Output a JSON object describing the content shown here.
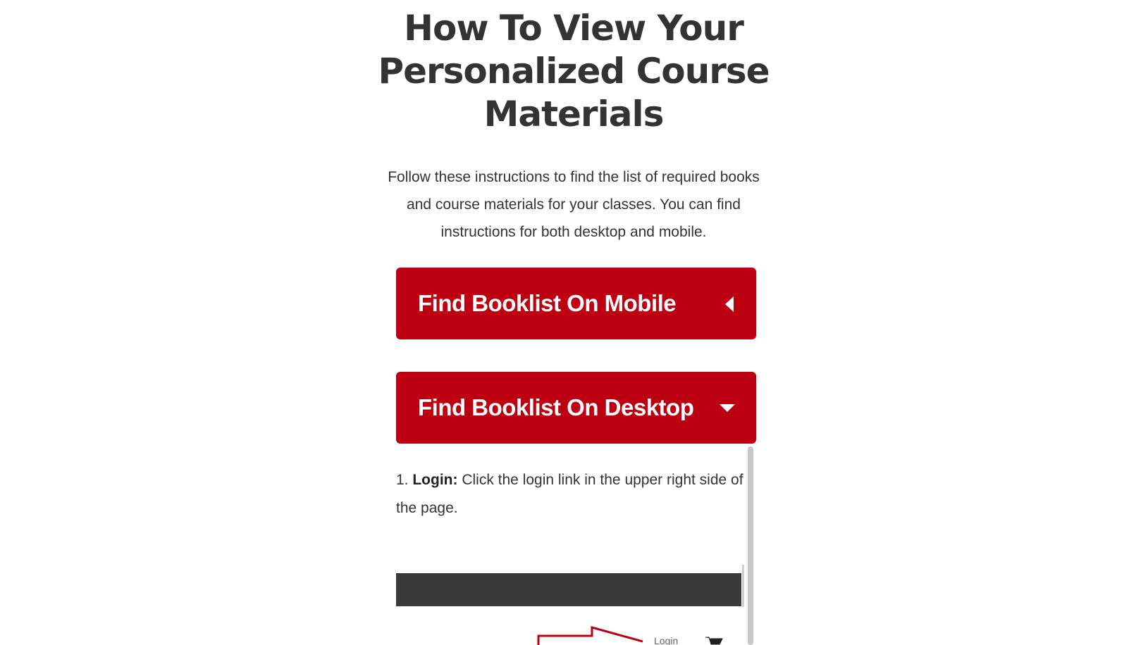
{
  "page": {
    "title": "How To View Your Personalized Course Materials",
    "intro": "Follow these instructions to find the list of required books and course materials for your classes. You can find instructions for both desktop and mobile."
  },
  "accordions": [
    {
      "label": "Find Booklist On Mobile",
      "state": "collapsed",
      "icon": "caret-left-icon"
    },
    {
      "label": "Find Booklist On Desktop",
      "state": "expanded",
      "icon": "caret-down-icon"
    }
  ],
  "desktop_panel": {
    "step_number": "1.",
    "step_title": "Login:",
    "step_text": " Click the login link in the upper right side of the page.",
    "screenshot": {
      "login_label": "Login",
      "icons": [
        "cart-icon",
        "arrow-icon"
      ]
    }
  },
  "colors": {
    "accent": "#bc0011",
    "text": "#333333",
    "screenshot_bar": "#3a3a3a"
  }
}
